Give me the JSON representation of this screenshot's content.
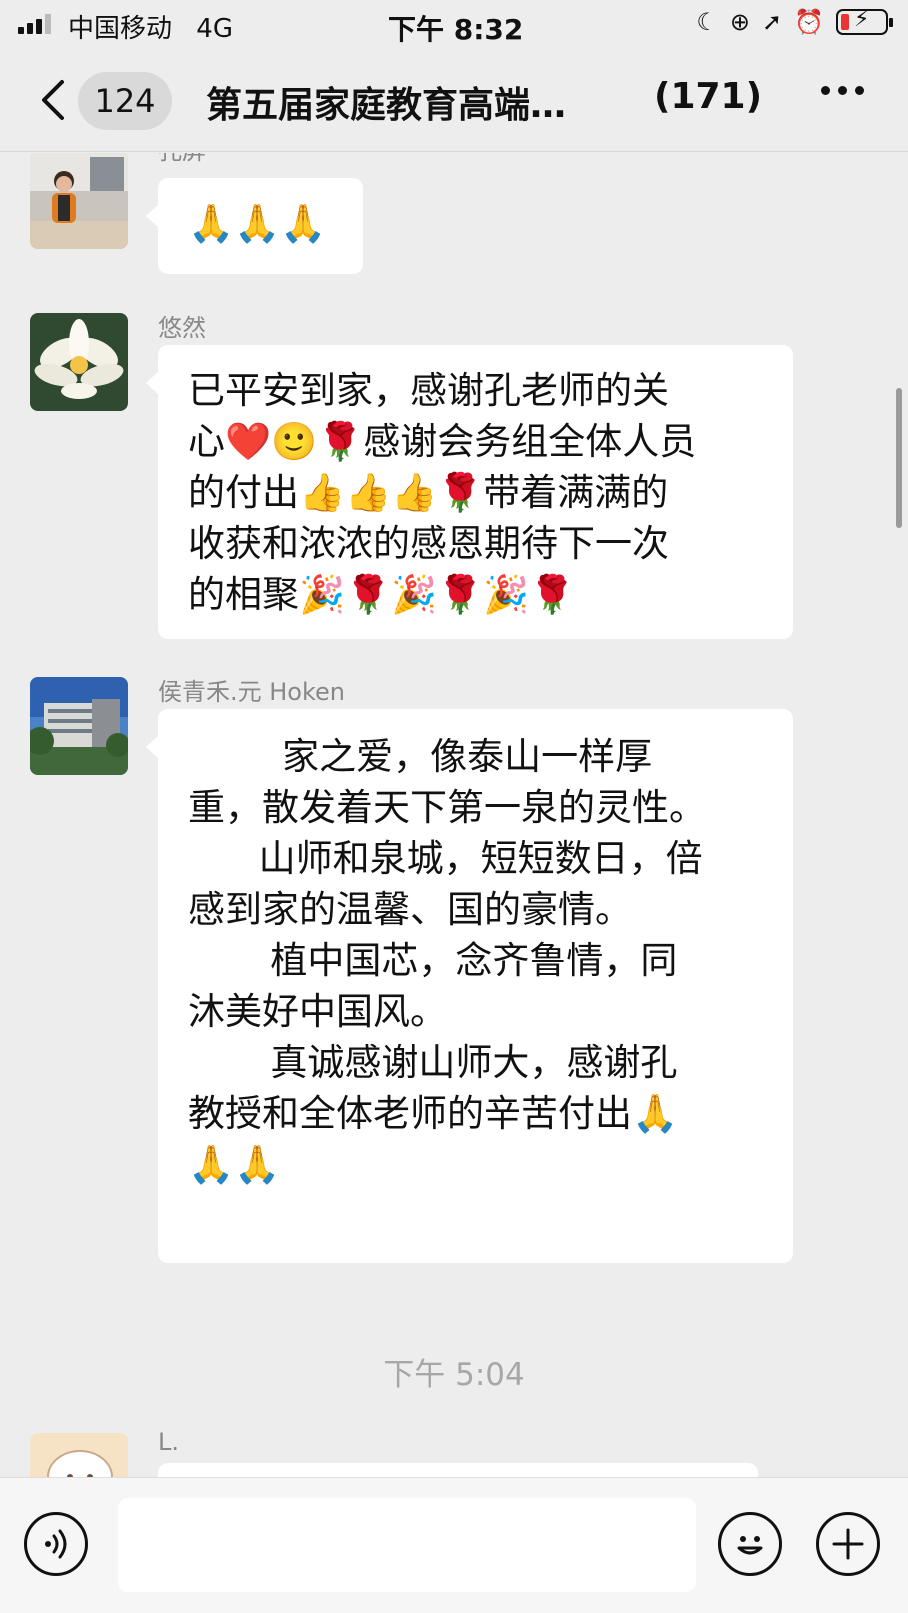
{
  "status_bar": {
    "carrier": "中国移动",
    "network": "4G",
    "time": "下午 8:32"
  },
  "nav": {
    "unread_badge": "124",
    "title": "第五届家庭教育高端…",
    "member_count": "(171)"
  },
  "messages": [
    {
      "sender": "孔屏",
      "text": "🙏🙏🙏"
    },
    {
      "sender": "悠然",
      "text": "已平安到家，感谢孔老师的关\n心❤️🙂🌹感谢会务组全体人员\n的付出👍👍👍🌹带着满满的\n收获和浓浓的感恩期待下一次\n的相聚🎉🌹🎉🌹🎉🌹"
    },
    {
      "sender": "侯青禾.元 Hoken",
      "text": "        家之爱，像泰山一样厚\n重，散发着天下第一泉的灵性。\n      山师和泉城，短短数日，倍\n感到家的温馨、国的豪情。\n       植中国芯，念齐鲁情，同\n沐美好中国风。\n       真诚感谢山师大，感谢孔\n教授和全体老师的辛苦付出🙏\n🙏🙏"
    },
    {
      "sender": "L.",
      "text": ""
    }
  ],
  "timestamp": "下午 5:04",
  "input": {
    "placeholder": ""
  }
}
